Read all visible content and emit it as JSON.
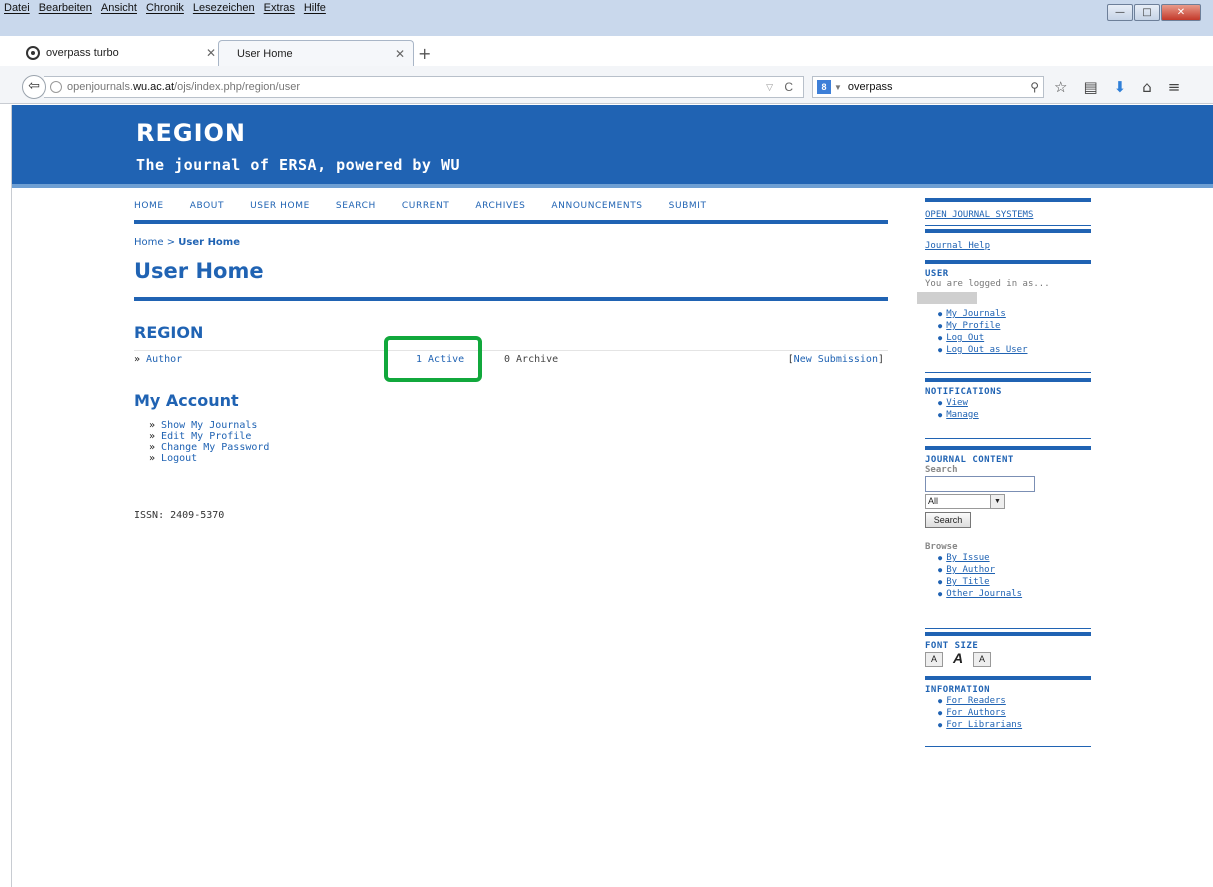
{
  "browser": {
    "menu": [
      "Datei",
      "Bearbeiten",
      "Ansicht",
      "Chronik",
      "Lesezeichen",
      "Extras",
      "Hilfe"
    ],
    "tabs": [
      {
        "label": "overpass turbo",
        "active": false
      },
      {
        "label": "User Home",
        "active": true
      }
    ],
    "url": {
      "prefix": "openjournals.",
      "domain": "wu.ac.at",
      "path": "/ojs/index.php/region/user"
    },
    "search_query": "overpass",
    "search_engine_icon": "g-icon"
  },
  "header": {
    "title": "REGION",
    "subtitle": "The journal of ERSA, powered by WU",
    "bg_color": "#2063b3"
  },
  "nav": [
    "HOME",
    "ABOUT",
    "USER HOME",
    "SEARCH",
    "CURRENT",
    "ARCHIVES",
    "ANNOUNCEMENTS",
    "SUBMIT"
  ],
  "breadcrumb": {
    "home": "Home",
    "sep": ">",
    "current": "User Home"
  },
  "page_title": "User Home",
  "journal": {
    "name": "REGION",
    "role": "Author",
    "active": "1 Active",
    "archive": "0 Archive",
    "new_submission": "New Submission"
  },
  "account": {
    "title": "My Account",
    "links": [
      "Show My Journals",
      "Edit My Profile",
      "Change My Password",
      "Logout"
    ]
  },
  "issn": "ISSN: 2409-5370",
  "sidebar": {
    "ojs": "OPEN JOURNAL SYSTEMS",
    "help": "Journal Help",
    "user": {
      "heading": "USER",
      "logged": "You are logged in as...",
      "links": [
        "My Journals",
        "My Profile",
        "Log Out",
        "Log Out as User"
      ]
    },
    "notifications": {
      "heading": "NOTIFICATIONS",
      "links": [
        "View",
        "Manage"
      ]
    },
    "journal_content": {
      "heading": "JOURNAL CONTENT",
      "search_label": "Search",
      "select_value": "All",
      "search_button": "Search",
      "browse_label": "Browse",
      "links": [
        "By Issue",
        "By Author",
        "By Title",
        "Other Journals"
      ]
    },
    "font_size": {
      "heading": "FONT SIZE",
      "small": "A",
      "medium": "A",
      "large": "A"
    },
    "information": {
      "heading": "INFORMATION",
      "links": [
        "For Readers",
        "For Authors",
        "For Librarians"
      ]
    }
  },
  "colors": {
    "accent": "#2063b3",
    "highlight": "#11a83c"
  }
}
